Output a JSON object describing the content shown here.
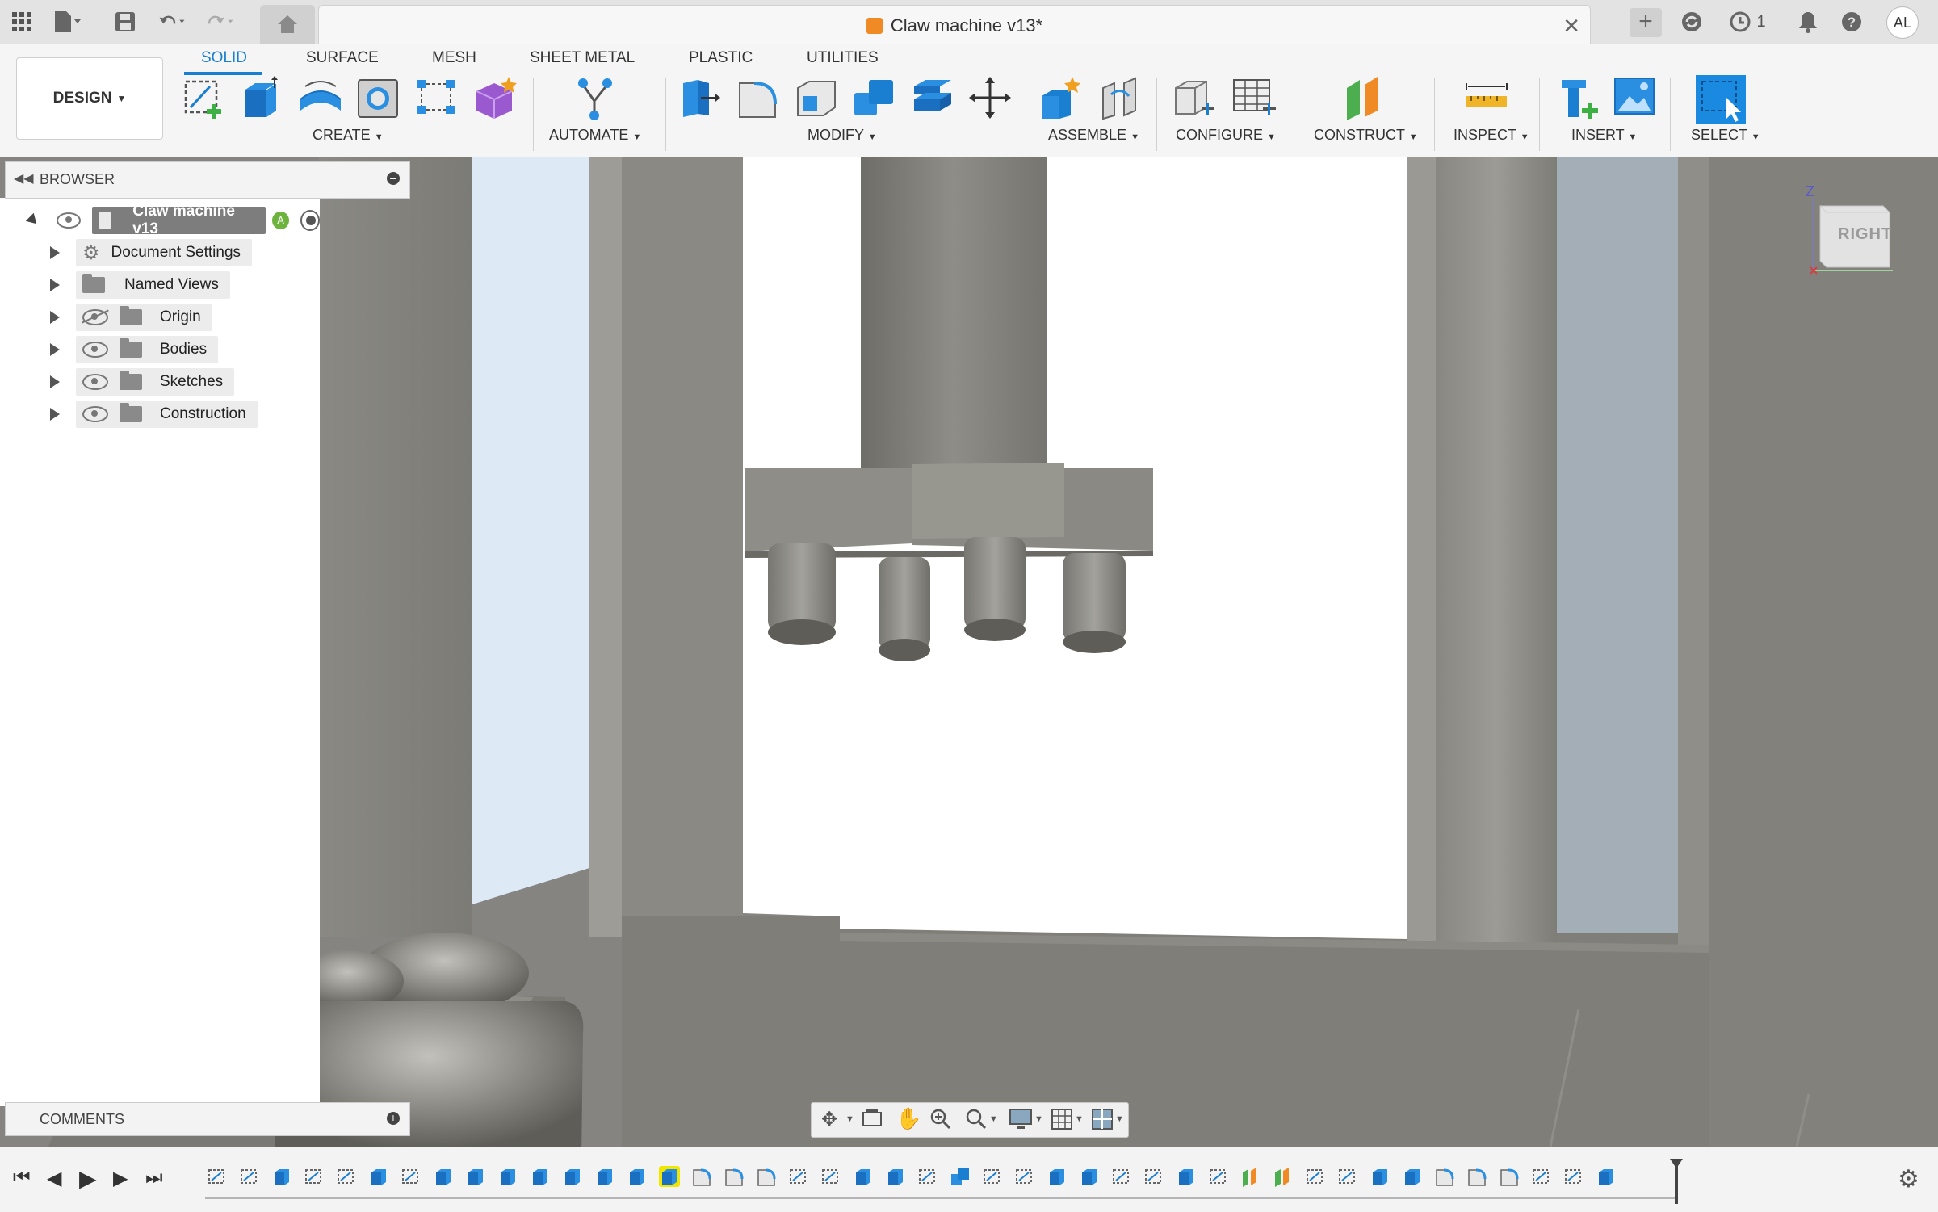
{
  "titlebar": {
    "doc_title": "Claw machine v13*",
    "job_count": "1",
    "user_initials": "AL",
    "close_glyph": "✕",
    "new_tab_glyph": "+"
  },
  "toolbar": {
    "workspace": "DESIGN",
    "tabs": [
      {
        "label": "SOLID",
        "active": true
      },
      {
        "label": "SURFACE",
        "active": false
      },
      {
        "label": "MESH",
        "active": false
      },
      {
        "label": "SHEET METAL",
        "active": false
      },
      {
        "label": "PLASTIC",
        "active": false
      },
      {
        "label": "UTILITIES",
        "active": false
      }
    ],
    "groups": [
      "CREATE",
      "AUTOMATE",
      "MODIFY",
      "ASSEMBLE",
      "CONFIGURE",
      "CONSTRUCT",
      "INSPECT",
      "INSERT",
      "SELECT"
    ],
    "accent": "#1a7fd0"
  },
  "browser": {
    "title": "BROWSER",
    "root": "Claw machine v13",
    "items": [
      {
        "label": "Document Settings",
        "icon": "gear-icon"
      },
      {
        "label": "Named Views",
        "icon": "folder-icon"
      },
      {
        "label": "Origin",
        "icon": "folder-icon",
        "visibility": "hidden"
      },
      {
        "label": "Bodies",
        "icon": "folder-icon",
        "visibility": "visible"
      },
      {
        "label": "Sketches",
        "icon": "folder-icon",
        "visibility": "visible"
      },
      {
        "label": "Construction",
        "icon": "folder-icon",
        "visibility": "visible"
      }
    ]
  },
  "comments": {
    "title": "COMMENTS"
  },
  "viewcube": {
    "face": "RIGHT",
    "axis_z": "Z"
  }
}
